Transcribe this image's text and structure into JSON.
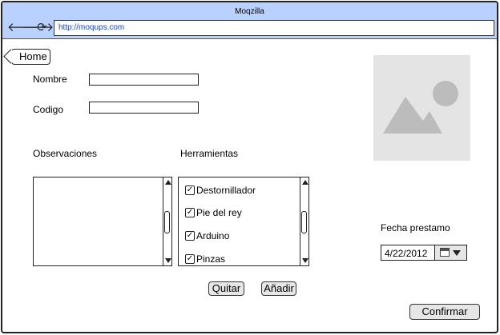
{
  "browser": {
    "title": "Moqzilla",
    "url": "http://moqups.com"
  },
  "home_button": "Home",
  "form": {
    "nombre_label": "Nombre",
    "nombre_value": "",
    "codigo_label": "Codigo",
    "codigo_value": "",
    "observaciones_label": "Observaciones",
    "herramientas_label": "Herramientas",
    "herramientas": [
      {
        "label": "Destornillador",
        "checked": true
      },
      {
        "label": "Pie  del rey",
        "checked": true
      },
      {
        "label": "Arduino",
        "checked": true
      },
      {
        "label": "Pinzas",
        "checked": true
      }
    ],
    "fecha_label": "Fecha prestamo",
    "fecha_value": "4/22/2012"
  },
  "buttons": {
    "quitar": "Quitar",
    "anadir": "Añadir",
    "confirmar": "Confirmar"
  },
  "icons": {
    "back": "arrow-left-icon",
    "forward": "arrow-right-icon",
    "reload": "reload-icon",
    "check": "✓"
  }
}
